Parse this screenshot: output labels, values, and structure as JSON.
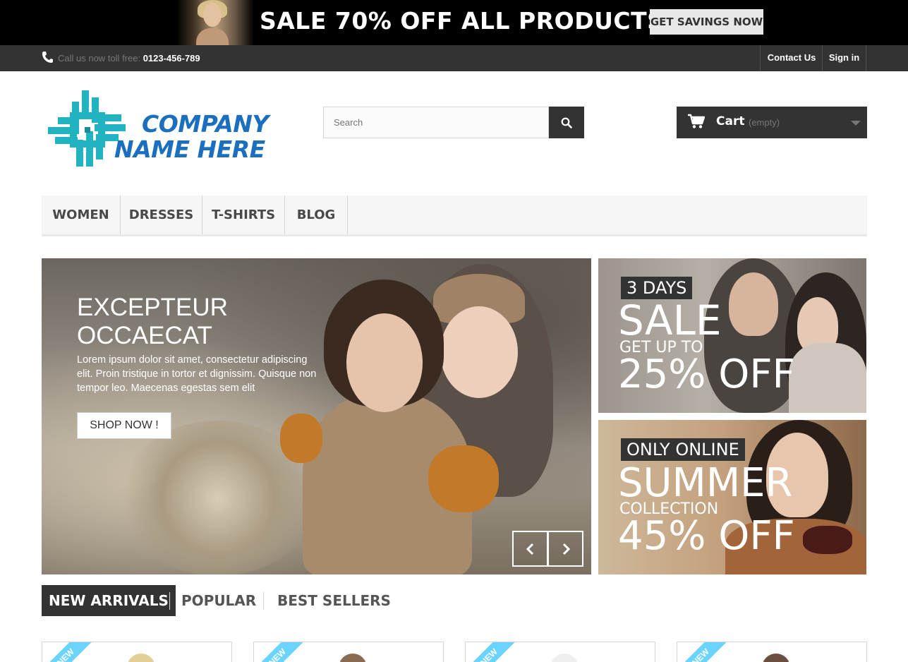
{
  "promo": {
    "text": "SALE 70% OFF ALL PRODUCTS",
    "button": "GET SAVINGS NOW"
  },
  "topbar": {
    "call_prefix": "Call us now toll free:",
    "phone": "0123-456-789",
    "contact": "Contact Us",
    "signin": "Sign in"
  },
  "logo": {
    "line1": "COMPANY",
    "line2": "NAME HERE"
  },
  "search": {
    "placeholder": "Search"
  },
  "cart": {
    "label": "Cart",
    "status": "(empty)"
  },
  "menu": {
    "items": [
      "WOMEN",
      "DRESSES",
      "T-SHIRTS",
      "BLOG"
    ]
  },
  "slider": {
    "title_line1": "EXCEPTEUR",
    "title_line2": "OCCAECAT",
    "description": "Lorem ipsum dolor sit amet, consectetur adipiscing elit. Proin tristique in tortor et dignissim. Quisque non tempor leo. Maecenas egestas sem elit",
    "button": "SHOP NOW !"
  },
  "banner1": {
    "tag": "3 DAYS",
    "headline": "SALE",
    "sub": "GET UP TO",
    "offer": "25% OFF"
  },
  "banner2": {
    "tag": "ONLY ONLINE",
    "headline": "SUMMER",
    "sub": "COLLECTION",
    "offer": "45% OFF"
  },
  "tabs": [
    "NEW ARRIVALS",
    "POPULAR",
    "BEST SELLERS"
  ],
  "products": {
    "ribbon": "NEW"
  },
  "colors": {
    "dark": "#333333",
    "accent_blue": "#1c6fbe",
    "logo_teal": "#22b3c1",
    "ribbon": "#6ad4ff"
  }
}
